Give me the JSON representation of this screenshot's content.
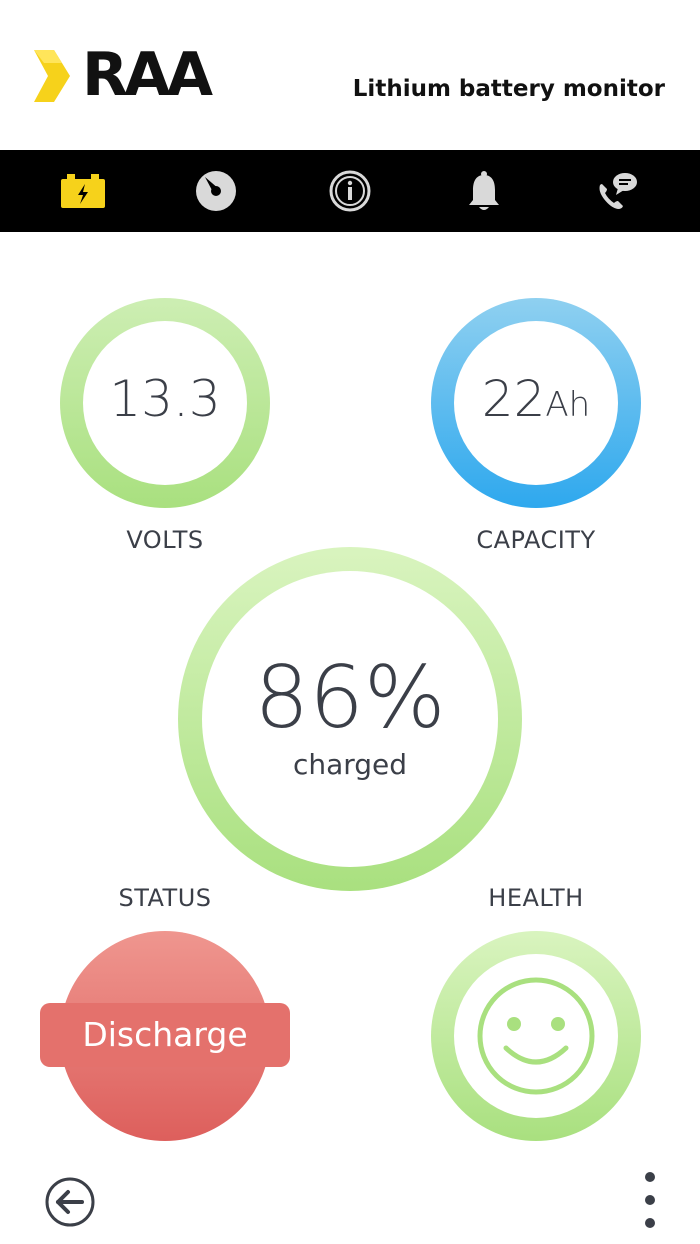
{
  "header": {
    "brand": "RAA",
    "title": "Lithium battery monitor"
  },
  "nav": {
    "items": [
      {
        "icon": "battery-icon",
        "active": true
      },
      {
        "icon": "gauge-icon",
        "active": false
      },
      {
        "icon": "info-icon",
        "active": false
      },
      {
        "icon": "bell-icon",
        "active": false
      },
      {
        "icon": "phone-chat-icon",
        "active": false
      }
    ]
  },
  "volts": {
    "value": "13.3",
    "label": "VOLTS"
  },
  "capacity": {
    "value": "22",
    "unit": "Ah",
    "label": "CAPACITY"
  },
  "charge": {
    "value": "86%",
    "sub": "charged"
  },
  "status": {
    "label": "STATUS",
    "value": "Discharge"
  },
  "health": {
    "label": "HEALTH",
    "icon": "smiley-icon"
  },
  "colors": {
    "accent_yellow": "#f6d21b",
    "ring_green": "#a9e07f",
    "ring_blue": "#2ea8ee",
    "status_red": "#e4716c",
    "text": "#3b3f48"
  },
  "footer": {
    "back_icon": "back-arrow-icon",
    "more_icon": "more-vertical-icon"
  }
}
